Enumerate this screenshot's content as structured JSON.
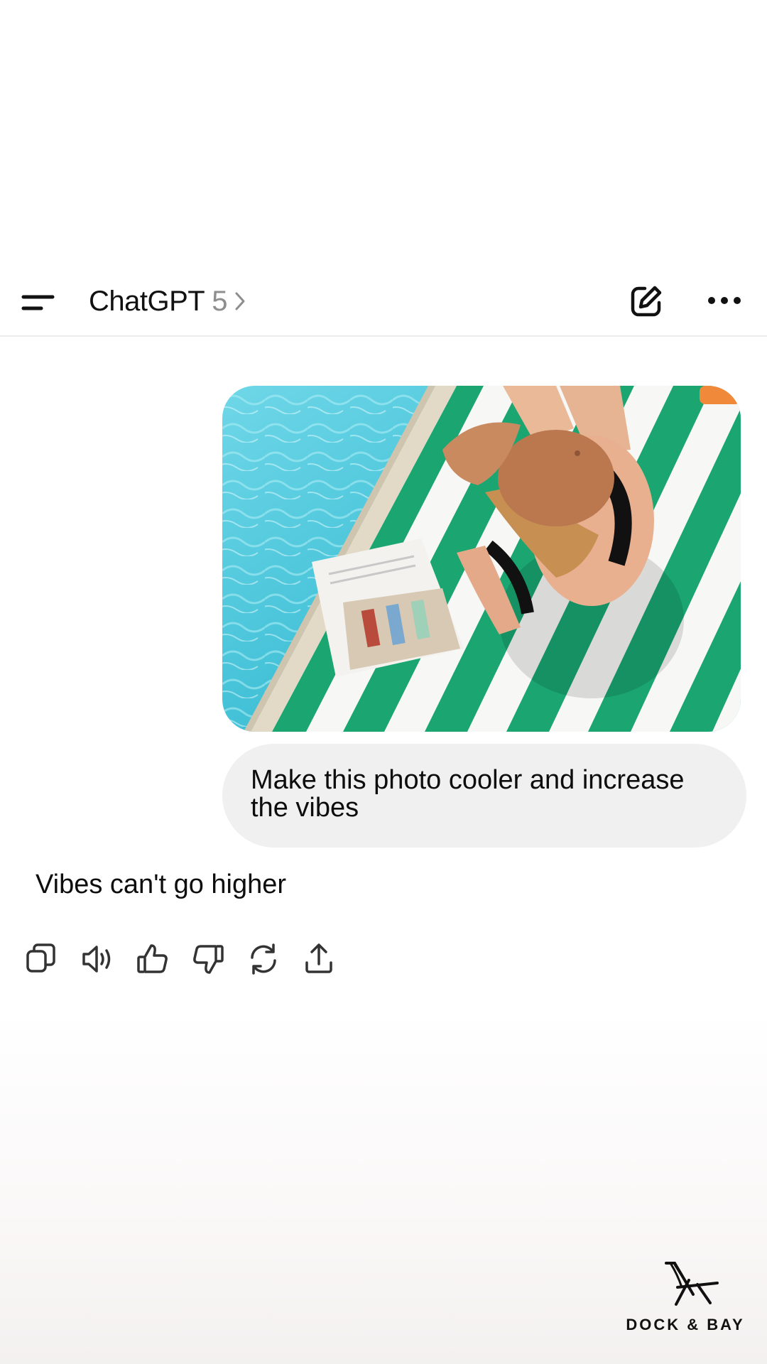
{
  "header": {
    "model_name": "ChatGPT",
    "model_version": "5",
    "icons": {
      "menu": "menu-icon",
      "chevron": "chevron-right-icon",
      "compose": "compose-icon",
      "more": "more-icon"
    }
  },
  "conversation": {
    "user_image": "pool-towel-photo",
    "user_message": "Make this photo cooler and increase the vibes",
    "assistant_message": "Vibes can't go higher",
    "actions": [
      "copy-icon",
      "read-aloud-icon",
      "thumbs-up-icon",
      "thumbs-down-icon",
      "regenerate-icon",
      "share-icon"
    ]
  },
  "watermark": {
    "text": "DOCK & BAY"
  },
  "colors": {
    "pool": "#4fc6d9",
    "towel_green": "#1aa571",
    "cap": "#b9774d",
    "bubble": "#f0f0f0"
  }
}
